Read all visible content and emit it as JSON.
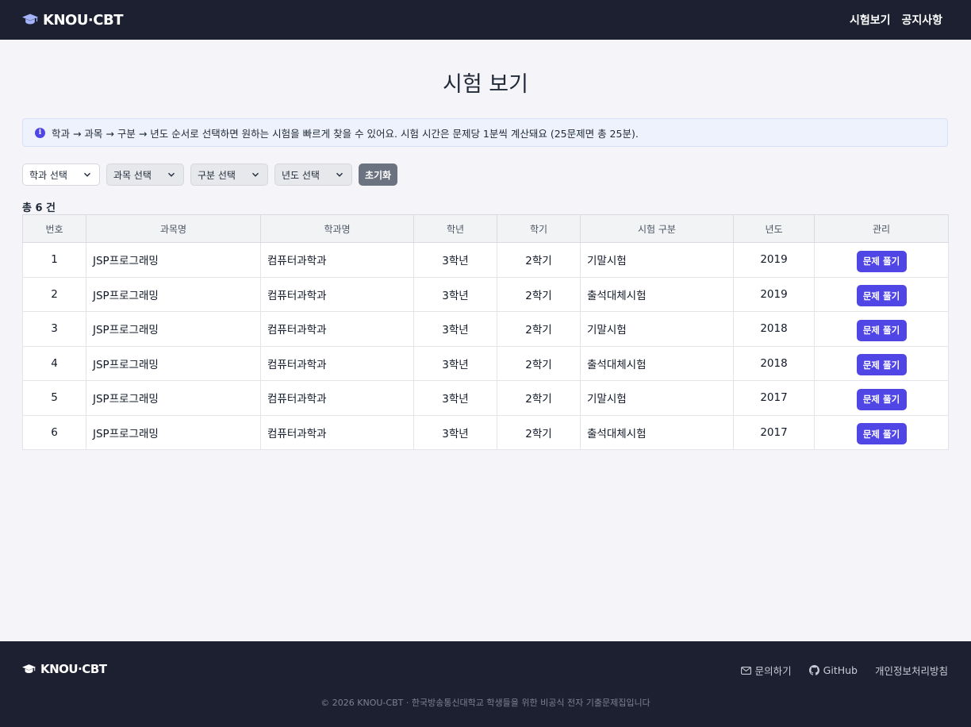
{
  "header": {
    "brand": "KNOU·CBT",
    "nav": [
      "시험보기",
      "공지사항"
    ]
  },
  "main": {
    "title": "시험 보기",
    "info_text": "학과 → 과목 → 구분 → 년도 순서로 선택하면 원하는 시험을 빠르게 찾을 수 있어요. 시험 시간은 문제당 1분씩 계산돼요 (25문제면 총 25분).",
    "info_icon": "i",
    "filters": {
      "department": "학과 선택",
      "subject": "과목 선택",
      "category": "구분 선택",
      "year": "년도 선택",
      "reset": "초기화"
    },
    "total": "총 6 건",
    "table": {
      "headers": [
        "번호",
        "과목명",
        "학과명",
        "학년",
        "학기",
        "시험 구분",
        "년도",
        "관리"
      ],
      "action_label": "문제 풀기",
      "rows": [
        [
          "1",
          "JSP프로그래밍",
          "컴퓨터과학과",
          "3학년",
          "2학기",
          "기말시험",
          "2019"
        ],
        [
          "2",
          "JSP프로그래밍",
          "컴퓨터과학과",
          "3학년",
          "2학기",
          "출석대체시험",
          "2019"
        ],
        [
          "3",
          "JSP프로그래밍",
          "컴퓨터과학과",
          "3학년",
          "2학기",
          "기말시험",
          "2018"
        ],
        [
          "4",
          "JSP프로그래밍",
          "컴퓨터과학과",
          "3학년",
          "2학기",
          "출석대체시험",
          "2018"
        ],
        [
          "5",
          "JSP프로그래밍",
          "컴퓨터과학과",
          "3학년",
          "2학기",
          "기말시험",
          "2017"
        ],
        [
          "6",
          "JSP프로그래밍",
          "컴퓨터과학과",
          "3학년",
          "2학기",
          "출석대체시험",
          "2017"
        ]
      ]
    }
  },
  "footer": {
    "brand": "KNOU·CBT",
    "links": [
      "문의하기",
      "GitHub",
      "개인정보처리방침"
    ],
    "copyright": "© 2026 KNOU-CBT · 한국방송통신대학교 학생들을 위한 비공식 전자 기출문제집입니다"
  },
  "colors": {
    "header_bg": "#1d2030",
    "accent": "#4f46e5",
    "page_bg": "#f5f5f9",
    "info_bg": "#eef2fc",
    "reset_bg": "#6b7280"
  }
}
